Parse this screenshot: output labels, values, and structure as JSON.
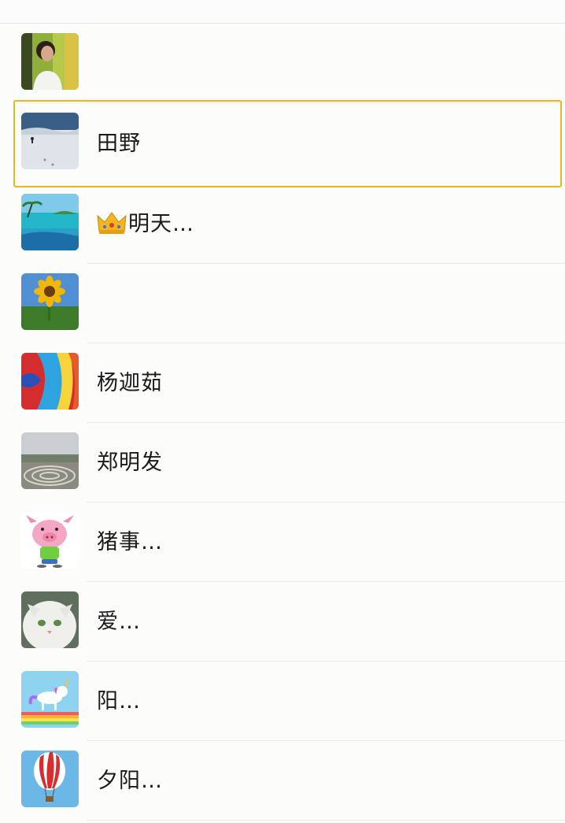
{
  "contacts": [
    {
      "name": "",
      "avatar_icon": "girl-portrait-icon"
    },
    {
      "name": "田野",
      "avatar_icon": "snowfield-icon",
      "selected": true
    },
    {
      "name": "明天…",
      "avatar_icon": "tropical-beach-icon",
      "prefix_icon": "crown-icon"
    },
    {
      "name": "",
      "avatar_icon": "sunflower-icon"
    },
    {
      "name": "杨迦茹",
      "avatar_icon": "abstract-paint-icon"
    },
    {
      "name": "郑明发",
      "avatar_icon": "stone-spiral-icon"
    },
    {
      "name": "猪事…",
      "avatar_icon": "cartoon-pig-icon"
    },
    {
      "name": "爱…",
      "avatar_icon": "persian-cat-icon"
    },
    {
      "name": "阳…",
      "avatar_icon": "unicorn-rainbow-icon"
    },
    {
      "name": "夕阳…",
      "avatar_icon": "hot-air-balloon-icon"
    }
  ],
  "colors": {
    "selection_border": "#e6b81f",
    "divider": "#ebebeb"
  }
}
